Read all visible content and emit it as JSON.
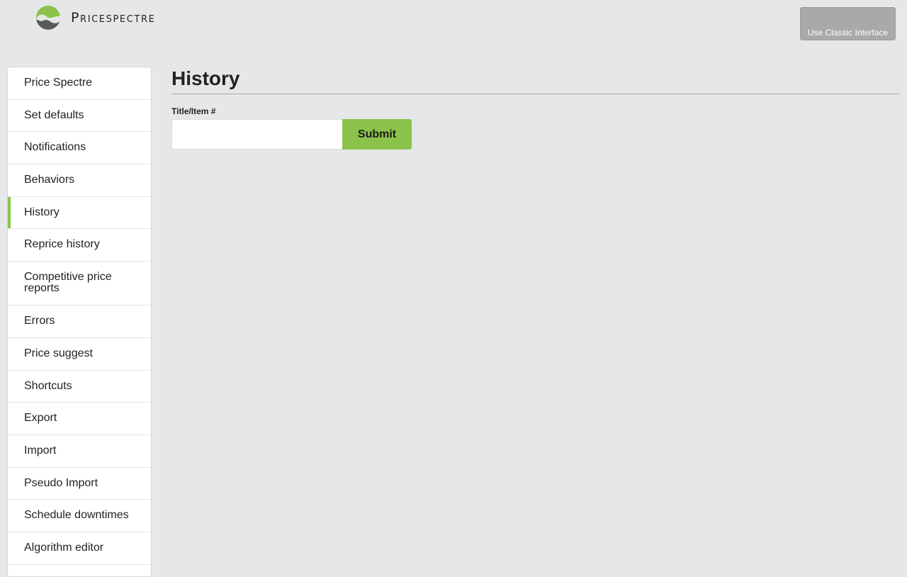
{
  "header": {
    "brand": "Pricespectre",
    "logo_icon": "pricespectre-logo-icon",
    "classic_button_label": "Use Classic Interface"
  },
  "sidebar": {
    "items": [
      {
        "label": "Price Spectre"
      },
      {
        "label": "Set defaults"
      },
      {
        "label": "Notifications"
      },
      {
        "label": "Behaviors"
      },
      {
        "label": "History",
        "active": true
      },
      {
        "label": "Reprice history"
      },
      {
        "label": "Competitive price reports"
      },
      {
        "label": "Errors"
      },
      {
        "label": "Price suggest"
      },
      {
        "label": "Shortcuts"
      },
      {
        "label": "Export"
      },
      {
        "label": "Import"
      },
      {
        "label": "Pseudo Import"
      },
      {
        "label": "Schedule downtimes"
      },
      {
        "label": "Algorithm editor"
      }
    ]
  },
  "main": {
    "title": "History",
    "search": {
      "label": "Title/Item #",
      "value": "",
      "placeholder": "",
      "submit_label": "Submit"
    }
  },
  "colors": {
    "accent": "#8bc34a",
    "background": "#e6e7e9",
    "classic_button": "#a9a9a9"
  }
}
